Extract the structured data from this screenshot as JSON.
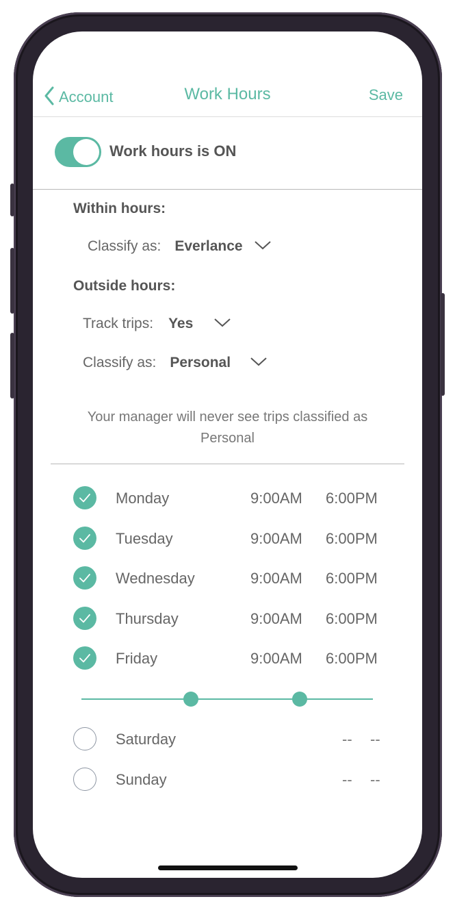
{
  "nav": {
    "back_label": "Account",
    "title": "Work Hours",
    "save_label": "Save"
  },
  "toggle": {
    "label": "Work hours is ON",
    "state": "on"
  },
  "within": {
    "heading": "Within hours:",
    "classify_label": "Classify as:",
    "classify_value": "Everlance"
  },
  "outside": {
    "heading": "Outside hours:",
    "track_label": "Track trips:",
    "track_value": "Yes",
    "classify_label": "Classify as:",
    "classify_value": "Personal"
  },
  "note": "Your manager will never see trips classified as Personal",
  "days": [
    {
      "name": "Monday",
      "checked": true,
      "start": "9:00AM",
      "end": "6:00PM"
    },
    {
      "name": "Tuesday",
      "checked": true,
      "start": "9:00AM",
      "end": "6:00PM"
    },
    {
      "name": "Wednesday",
      "checked": true,
      "start": "9:00AM",
      "end": "6:00PM"
    },
    {
      "name": "Thursday",
      "checked": true,
      "start": "9:00AM",
      "end": "6:00PM"
    },
    {
      "name": "Friday",
      "checked": true,
      "start": "9:00AM",
      "end": "6:00PM"
    }
  ],
  "weekend": [
    {
      "name": "Saturday",
      "checked": false,
      "start": "--",
      "end": "--"
    },
    {
      "name": "Sunday",
      "checked": false,
      "start": "--",
      "end": "--"
    }
  ],
  "colors": {
    "accent": "#5bb9a3",
    "text": "#555555"
  }
}
